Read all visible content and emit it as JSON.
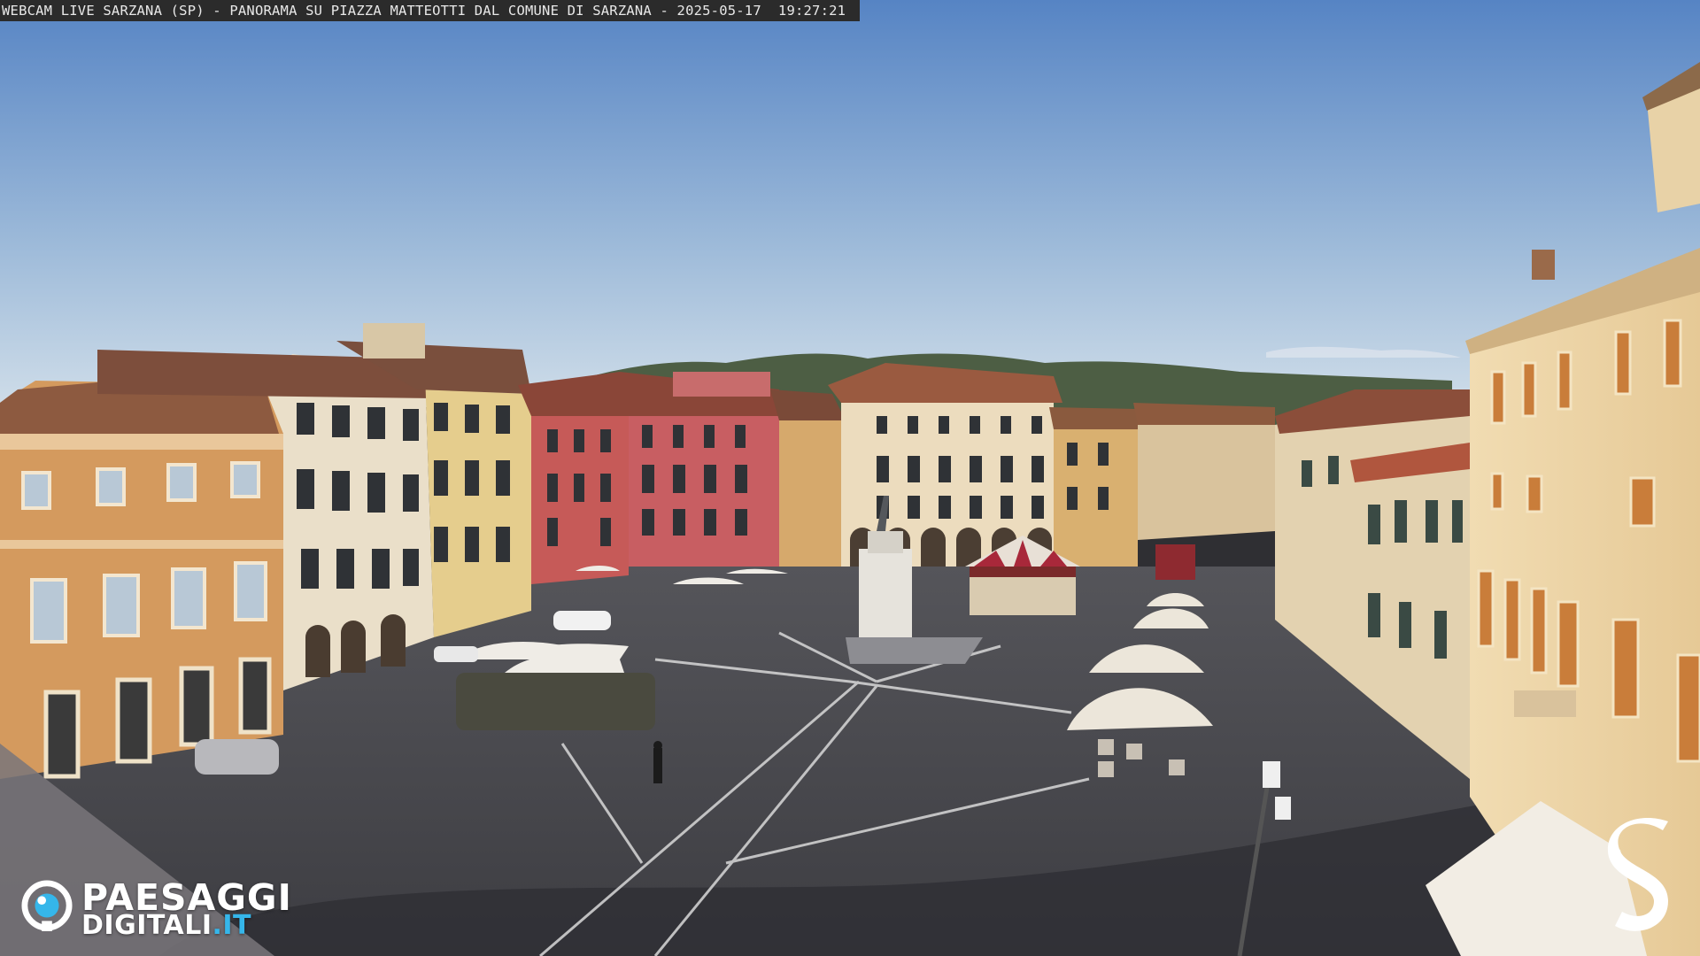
{
  "caption": {
    "text": "WEBCAM LIVE SARZANA (SP) - PANORAMA SU PIAZZA MATTEOTTI DAL COMUNE DI SARZANA - 2025-05-17  19:27:21"
  },
  "logo_left": {
    "line1": "PAESAGGI",
    "line2_main": "DIGITALI",
    "line2_suffix": ".IT",
    "accent_color": "#35b6ea",
    "icon": "eye-icon"
  },
  "logo_right": {
    "glyph": "S",
    "icon": "s-monogram-logo"
  },
  "colors": {
    "sky_top": "#5f8fcc",
    "sky_bottom": "#c7d8e8",
    "pavement": "#46464b",
    "orange_building": "#d89a5a",
    "red_building": "#c55a5a",
    "cream_building": "#e9d8b8",
    "yellow_building": "#e8cf8c"
  }
}
